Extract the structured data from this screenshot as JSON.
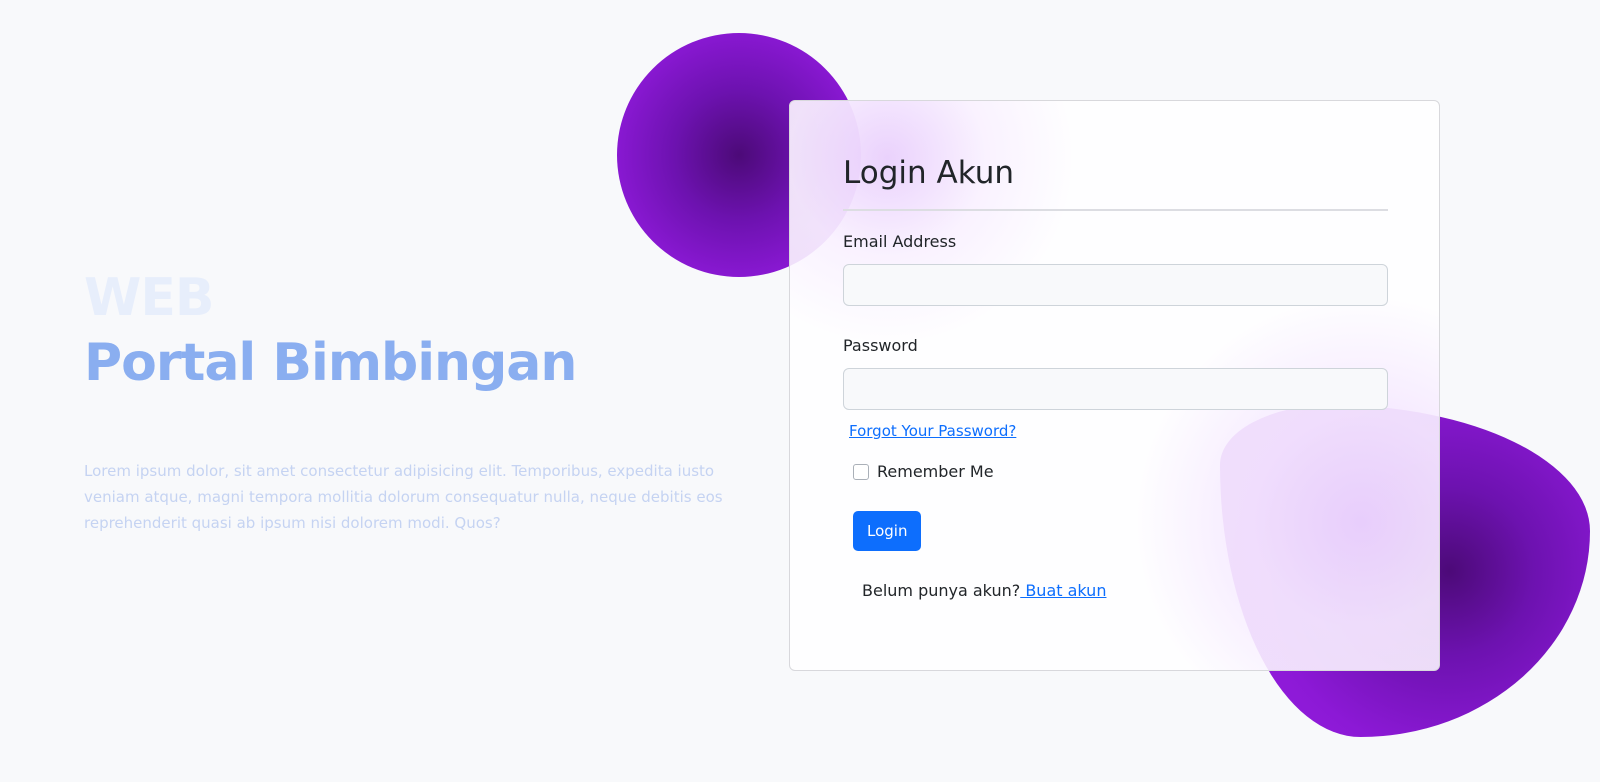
{
  "hero": {
    "eyebrow": "WEB",
    "title": "Portal Bimbingan",
    "description": "Lorem ipsum dolor, sit amet consectetur adipisicing elit. Temporibus, expedita iusto veniam atque, magni tempora mollitia dolorum consequatur nulla, neque debitis eos reprehenderit quasi ab ipsum nisi dolorem modi. Quos?"
  },
  "login": {
    "title": "Login Akun",
    "email_label": "Email Address",
    "email_value": "",
    "password_label": "Password",
    "password_value": "",
    "forgot_link": "Forgot Your Password?",
    "remember_label": "Remember Me",
    "remember_checked": false,
    "submit_label": "Login",
    "signup_prompt": "Belum punya akun?",
    "signup_link": " Buat akun"
  },
  "colors": {
    "accent": "#0d6efd",
    "shape": "#8c19d6",
    "title": "#8aaef0"
  }
}
